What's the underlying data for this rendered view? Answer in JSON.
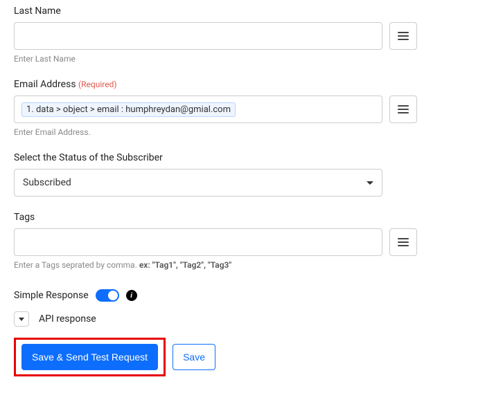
{
  "fields": {
    "lastName": {
      "label": "Last Name",
      "helper": "Enter Last Name"
    },
    "email": {
      "label": "Email Address",
      "requiredTag": "(Required)",
      "tokenText": "1. data > object > email : humphreydan@gmial.com",
      "helper": "Enter Email Address."
    },
    "status": {
      "label": "Select the Status of the Subscriber",
      "selected": "Subscribed"
    },
    "tags": {
      "label": "Tags",
      "helperPrefix": "Enter a Tags seprated by comma. ",
      "helperBold": "ex: \"Tag1\", \"Tag2\", \"Tag3\""
    }
  },
  "simpleResponse": {
    "label": "Simple Response"
  },
  "apiResponse": {
    "label": "API response"
  },
  "buttons": {
    "saveSend": "Save & Send Test Request",
    "save": "Save"
  }
}
